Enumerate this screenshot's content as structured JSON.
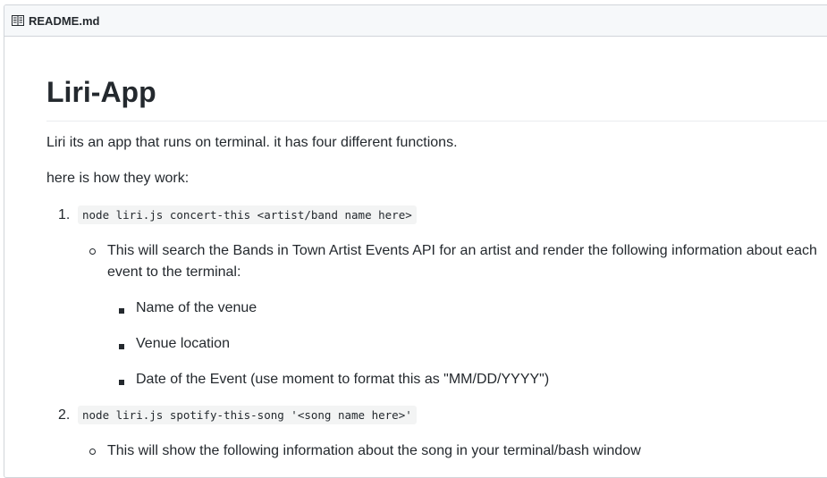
{
  "file_header": {
    "icon": "book-icon",
    "filename": "README.md"
  },
  "readme": {
    "title": "Liri-App",
    "intro": "Liri its an app that runs on terminal. it has four different functions.",
    "how_it_works": "here is how they work:",
    "steps": [
      {
        "number": "1.",
        "command": "node liri.js concert-this <artist/band name here>",
        "description_line1": "This will search the Bands in Town Artist Events API for an artist and render the following information about each",
        "description_line2": "event to the terminal:",
        "details": [
          "Name of the venue",
          "Venue location",
          "Date of the Event (use moment to format this as \"MM/DD/YYYY\")"
        ]
      },
      {
        "number": "2.",
        "command": "node liri.js spotify-this-song '<song name here>'",
        "description_line1": "This will show the following information about the song in your terminal/bash window"
      }
    ]
  }
}
